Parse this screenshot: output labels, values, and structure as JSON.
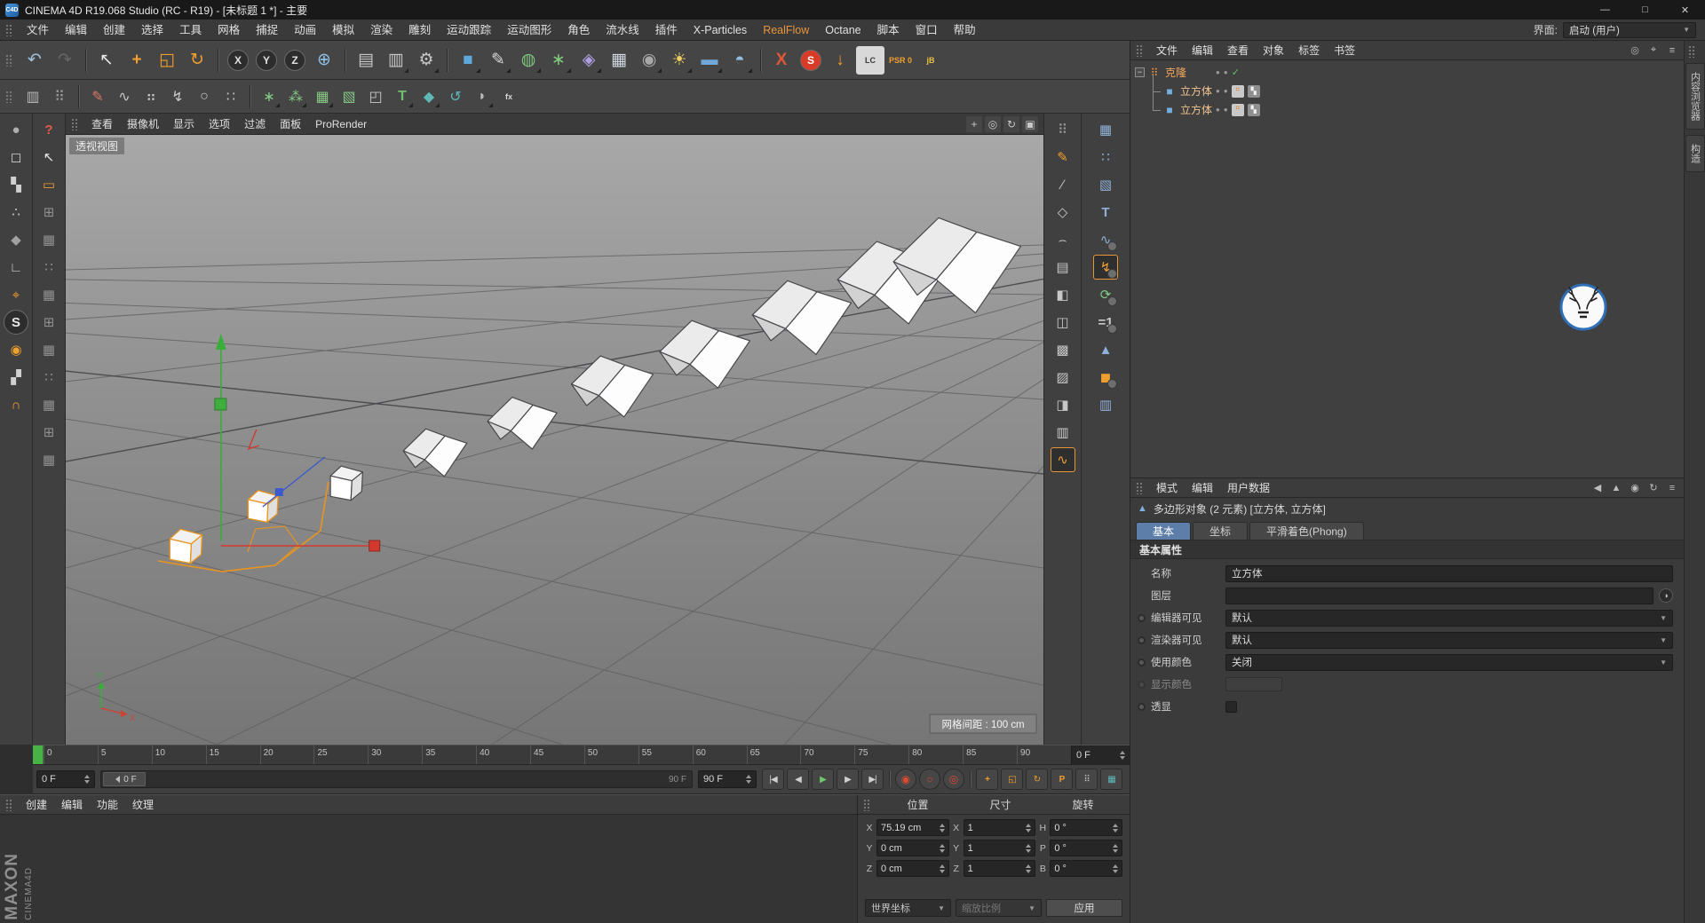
{
  "theme": {
    "accent_orange": "#ef9f2e",
    "tab_active_blue": "#5d7ea8",
    "play_green": "#6ec86e",
    "playhead_green": "#47b347"
  },
  "titlebar": {
    "app_icon": "C4D",
    "title": "CINEMA 4D R19.068 Studio (RC - R19) - [未标题 1 *] - 主要",
    "minimize": "—",
    "maximize": "□",
    "close": "✕"
  },
  "menubar": {
    "items": [
      {
        "label": "文件"
      },
      {
        "label": "编辑"
      },
      {
        "label": "创建"
      },
      {
        "label": "选择"
      },
      {
        "label": "工具"
      },
      {
        "label": "网格"
      },
      {
        "label": "捕捉"
      },
      {
        "label": "动画"
      },
      {
        "label": "模拟"
      },
      {
        "label": "渲染"
      },
      {
        "label": "雕刻"
      },
      {
        "label": "运动跟踪"
      },
      {
        "label": "运动图形"
      },
      {
        "label": "角色"
      },
      {
        "label": "流水线"
      },
      {
        "label": "插件"
      },
      {
        "label": "X-Particles"
      },
      {
        "label": "RealFlow",
        "accent": true
      },
      {
        "label": "Octane"
      },
      {
        "label": "脚本"
      },
      {
        "label": "窗口"
      },
      {
        "label": "帮助"
      }
    ],
    "interface_label": "界面:",
    "interface_value": "启动 (用户)"
  },
  "toolbar_main": {
    "icons": [
      {
        "name": "undo-icon",
        "glyph": "↶",
        "color": "#9fc0d8"
      },
      {
        "name": "redo-icon",
        "glyph": "↷",
        "color": "#666666",
        "disabled": true
      },
      {
        "sep": true
      },
      {
        "name": "live-selection-icon",
        "glyph": "↖",
        "color": "#e8e8e8"
      },
      {
        "name": "move-tool-icon",
        "glyph": "+",
        "color": "#ef9f2e",
        "bold": true
      },
      {
        "name": "scale-tool-icon",
        "glyph": "◱",
        "color": "#ef9f2e"
      },
      {
        "name": "rotate-tool-icon",
        "glyph": "↻",
        "color": "#ef9f2e"
      },
      {
        "sep": true
      },
      {
        "name": "lock-x-axis-button",
        "glyph": "X",
        "circle": true,
        "color": "#e0e0e0"
      },
      {
        "name": "lock-y-axis-button",
        "glyph": "Y",
        "circle": true,
        "color": "#e0e0e0"
      },
      {
        "name": "lock-z-axis-button",
        "glyph": "Z",
        "circle": true,
        "color": "#e0e0e0"
      },
      {
        "name": "coordinate-system-button",
        "glyph": "⊕",
        "color": "#8fc0e8"
      },
      {
        "sep": true
      },
      {
        "name": "render-view-button",
        "glyph": "▤",
        "color": "#c8c8c8"
      },
      {
        "name": "render-picture-viewer-button",
        "glyph": "▥",
        "color": "#c8c8c8",
        "corner": true
      },
      {
        "name": "render-settings-button",
        "glyph": "⚙",
        "color": "#c8c8c8",
        "corner": true
      },
      {
        "sep": true
      },
      {
        "name": "primitive-cube-button",
        "glyph": "■",
        "color": "#5fa8dc",
        "corner": true
      },
      {
        "name": "spline-pen-button",
        "glyph": "✎",
        "color": "#d8d8d8",
        "corner": true
      },
      {
        "name": "subdivision-surface-button",
        "glyph": "◍",
        "color": "#7fca7f",
        "corner": true
      },
      {
        "name": "mograph-cloner-button",
        "glyph": "∗",
        "color": "#7fca7f",
        "corner": true
      },
      {
        "name": "deformer-button",
        "glyph": "◈",
        "color": "#b09fe0",
        "corner": true
      },
      {
        "name": "content-table-button",
        "glyph": "▦",
        "color": "#cfd8e2"
      },
      {
        "name": "camera-button",
        "glyph": "◉",
        "color": "#a8a8a8",
        "corner": true
      },
      {
        "name": "light-button",
        "glyph": "☀",
        "color": "#f0d060",
        "corner": true
      },
      {
        "name": "floor-button",
        "glyph": "▬",
        "color": "#6fa8d8",
        "corner": true
      },
      {
        "name": "sky-button",
        "glyph": "◓",
        "color": "#90bce0",
        "corner": true
      },
      {
        "sep": true
      },
      {
        "name": "xparticles-button",
        "glyph": "X",
        "color": "#e05838",
        "bold": true
      },
      {
        "name": "solo-plugin-button",
        "glyph": "S",
        "circle": true,
        "bg": "#d83c28",
        "color": "#ffffff"
      },
      {
        "name": "drop-to-floor-button",
        "glyph": "↓",
        "color": "#ef9f2e",
        "bold": true
      },
      {
        "name": "lc-plugin-button",
        "glyph": "LC",
        "txt": true,
        "bg": "#d8d8d8",
        "color": "#3a3a3a"
      },
      {
        "name": "psr-reset-button",
        "glyph": "PSR 0",
        "txt": true,
        "color": "#ef9f2e"
      },
      {
        "name": "jb-plugin-button",
        "glyph": "jB",
        "txt": true,
        "color": "#e8c040"
      }
    ]
  },
  "toolbar_modeling": {
    "icons": [
      {
        "name": "layout-panes-icon",
        "glyph": "▥",
        "color": "#b8b8b8"
      },
      {
        "name": "command-palette-icon",
        "glyph": "⠿",
        "color": "#9a9a9a"
      },
      {
        "sep": true
      },
      {
        "name": "sketch-pen-icon",
        "glyph": "✎",
        "color": "#d87868"
      },
      {
        "name": "sketch-smooth-icon",
        "glyph": "∿",
        "color": "#c8c8c8"
      },
      {
        "name": "spline-sketch-icon",
        "glyph": "⠶",
        "color": "#c8c8c8"
      },
      {
        "name": "spline-zigzag-icon",
        "glyph": "↯",
        "color": "#c8c8c8"
      },
      {
        "name": "spline-circle-icon",
        "glyph": "○",
        "color": "#c8c8c8"
      },
      {
        "name": "spline-grid-icon",
        "glyph": "∷",
        "color": "#c8c8c8"
      },
      {
        "sep": true
      },
      {
        "name": "atom-array-icon",
        "glyph": "∗",
        "color": "#84c884",
        "corner": true
      },
      {
        "name": "metaball-icon",
        "glyph": "⁂",
        "color": "#84c884",
        "corner": true
      },
      {
        "name": "boole-icon",
        "glyph": "▦",
        "color": "#84c884",
        "corner": true
      },
      {
        "name": "instance-icon",
        "glyph": "▧",
        "color": "#84c884"
      },
      {
        "name": "corner-tool-icon",
        "glyph": "◰",
        "color": "#c8c8c8"
      },
      {
        "name": "text-object-icon",
        "glyph": "T",
        "color": "#6fbf6f",
        "bold": true,
        "corner": true
      },
      {
        "name": "platonic-icon",
        "glyph": "◆",
        "color": "#5fb8b8",
        "corner": true
      },
      {
        "name": "helix-icon",
        "glyph": "↺",
        "color": "#5fb8b8"
      },
      {
        "name": "lathe-icon",
        "glyph": "◗",
        "color": "#b8b8b8",
        "corner": true
      },
      {
        "name": "xpresso-icon",
        "glyph": "fx",
        "txt": true,
        "color": "#d8d8d8"
      }
    ]
  },
  "left_toolbar_primary": {
    "icons": [
      {
        "name": "make-editable-icon",
        "glyph": "●",
        "color": "#b0b0b0"
      },
      {
        "name": "model-mode-icon",
        "glyph": "◻",
        "color": "#d0d0d0"
      },
      {
        "name": "texture-mode-icon",
        "glyph": "▚",
        "color": "#d0d0d0"
      },
      {
        "name": "points-mode-icon",
        "glyph": "∴",
        "color": "#d0d0d0"
      },
      {
        "name": "polygons-mode-icon",
        "glyph": "◆",
        "color": "#a0a0a0"
      },
      {
        "name": "workplane-mode-icon",
        "glyph": "∟",
        "color": "#d0d0d0"
      },
      {
        "name": "axis-mode-icon",
        "glyph": "⌖",
        "color": "#ef9f2e"
      },
      {
        "name": "viewport-solo-icon",
        "glyph": "S",
        "circle": true,
        "color": "#e8e8e8"
      },
      {
        "name": "paint-bucket-icon",
        "glyph": "◉",
        "color": "#ef9f2e"
      },
      {
        "name": "lock-workplane-icon",
        "glyph": "▞",
        "color": "#d0d0d0"
      },
      {
        "name": "snap-enable-icon",
        "glyph": "∩",
        "color": "#ef9f2e"
      }
    ]
  },
  "left_toolbar_secondary": {
    "icons": [
      {
        "name": "help-icon",
        "glyph": "?",
        "color": "#e05a48",
        "bold": true
      },
      {
        "name": "select-arrow-icon",
        "glyph": "↖",
        "color": "#e8e8e8"
      },
      {
        "name": "rectangle-select-icon",
        "glyph": "▭",
        "color": "#ef9f2e"
      },
      {
        "name": "move-palette-icon",
        "glyph": "⊞",
        "color": "#909090"
      },
      {
        "name": "scale-palette-icon",
        "glyph": "▦",
        "color": "#909090"
      },
      {
        "name": "rotate-palette-icon",
        "glyph": "∷",
        "color": "#909090"
      },
      {
        "name": "grid-palette-icon-1",
        "glyph": "▦",
        "color": "#909090"
      },
      {
        "name": "grid-palette-icon-2",
        "glyph": "⊞",
        "color": "#909090"
      },
      {
        "name": "grid-palette-icon-3",
        "glyph": "▦",
        "color": "#909090"
      },
      {
        "name": "grid-palette-icon-4",
        "glyph": "∷",
        "color": "#909090"
      },
      {
        "name": "grid-palette-icon-5",
        "glyph": "▦",
        "color": "#909090"
      },
      {
        "name": "grid-palette-icon-6",
        "glyph": "⊞",
        "color": "#909090"
      },
      {
        "name": "grid-palette-icon-7",
        "glyph": "▦",
        "color": "#909090"
      }
    ]
  },
  "viewport": {
    "menu": [
      {
        "label": "查看"
      },
      {
        "label": "摄像机"
      },
      {
        "label": "显示"
      },
      {
        "label": "选项"
      },
      {
        "label": "过滤"
      },
      {
        "label": "面板"
      },
      {
        "label": "ProRender"
      }
    ],
    "view_controls": [
      {
        "name": "pan-view-icon",
        "glyph": "+"
      },
      {
        "name": "zoom-view-icon",
        "glyph": "◎"
      },
      {
        "name": "orbit-view-icon",
        "glyph": "↻"
      },
      {
        "name": "maximize-view-icon",
        "glyph": "▣"
      }
    ],
    "label": "透视视图",
    "grid_info": "网格间距 : 100 cm"
  },
  "right_palette_a": {
    "icons": [
      {
        "name": "dots-palette-icon",
        "glyph": "⠿",
        "color": "#9a9a9a"
      },
      {
        "name": "spline-pen-icon",
        "glyph": "✎",
        "color": "#ef9f2e"
      },
      {
        "name": "knife-icon",
        "glyph": "∕",
        "color": "#c8c8c8"
      },
      {
        "name": "polygon-pen-icon",
        "glyph": "◇",
        "color": "#c8c8c8"
      },
      {
        "name": "arc-tool-icon",
        "glyph": "⌢",
        "color": "#c8c8c8"
      },
      {
        "name": "extrude-icon",
        "glyph": "▤",
        "color": "#c8c8c8"
      },
      {
        "name": "inner-extrude-icon",
        "glyph": "◧",
        "color": "#c8c8c8"
      },
      {
        "name": "bevel-icon",
        "glyph": "◫",
        "color": "#c8c8c8"
      },
      {
        "name": "bridge-icon",
        "glyph": "▩",
        "color": "#c8c8c8"
      },
      {
        "name": "stitch-sew-icon",
        "glyph": "▨",
        "color": "#c8c8c8"
      },
      {
        "name": "weld-icon",
        "glyph": "◨",
        "color": "#c8c8c8"
      },
      {
        "name": "close-polygon-icon",
        "glyph": "▥",
        "color": "#c8c8c8"
      },
      {
        "name": "spline-smooth-icon",
        "glyph": "∿",
        "color": "#ef9f2e",
        "selected": true
      }
    ]
  },
  "right_palette_b": {
    "icons": [
      {
        "name": "cloner-icon",
        "glyph": "▦",
        "color": "#8fb0d8"
      },
      {
        "name": "matrix-icon",
        "glyph": "∷",
        "color": "#8fb0d8"
      },
      {
        "name": "fracture-icon",
        "glyph": "▧",
        "color": "#8fb0d8"
      },
      {
        "name": "motext-icon",
        "glyph": "T",
        "color": "#8fb0d8",
        "bold": true
      },
      {
        "name": "tracer-icon",
        "glyph": "∿",
        "color": "#8fb0d8",
        "gear": true
      },
      {
        "name": "mospline-icon",
        "glyph": "↯",
        "color": "#ef9f2e",
        "selected": true,
        "gear": true
      },
      {
        "name": "random-effector-icon",
        "glyph": "⟳",
        "color": "#84c884",
        "gear": true
      },
      {
        "name": "plain-effector-icon",
        "glyph": "=1",
        "txt": true,
        "color": "#c8c8c8",
        "gear": true
      },
      {
        "name": "polyfx-icon",
        "glyph": "▲",
        "color": "#8fb0d8"
      },
      {
        "name": "pushapart-effector-icon",
        "glyph": "◼",
        "color": "#ef9f2e",
        "gear": true
      },
      {
        "name": "extrude-mo-icon",
        "glyph": "▥",
        "color": "#8fb0d8"
      }
    ]
  },
  "timeline": {
    "ticks": [
      "0",
      "5",
      "10",
      "15",
      "20",
      "25",
      "30",
      "35",
      "40",
      "45",
      "50",
      "55",
      "60",
      "65",
      "70",
      "75",
      "80",
      "85",
      "90"
    ],
    "current_frame": "0 F",
    "range_start": "0 F",
    "range_end": "90 F",
    "slider_handle_label": "0 F",
    "slider_end_label": "90 F",
    "transport": [
      {
        "name": "goto-start-button",
        "glyph": "|◀"
      },
      {
        "name": "previous-frame-button",
        "glyph": "◀"
      },
      {
        "name": "play-button",
        "glyph": "▶",
        "color": "#6ec86e"
      },
      {
        "name": "next-frame-button",
        "glyph": "▶"
      },
      {
        "name": "goto-end-button",
        "glyph": "▶|"
      },
      {
        "sep": true
      },
      {
        "name": "record-keyframe-button",
        "glyph": "◉",
        "color": "#e04a32",
        "round": true
      },
      {
        "name": "autokeying-button",
        "glyph": "○",
        "color": "#e04a32",
        "round": true
      },
      {
        "name": "keyframe-selection-button",
        "glyph": "◎",
        "color": "#e04a32",
        "round": true
      },
      {
        "sep": true
      },
      {
        "name": "position-key-toggle",
        "glyph": "+",
        "color": "#ef9f2e",
        "bold": true
      },
      {
        "name": "scale-key-toggle",
        "glyph": "◱",
        "color": "#ef9f2e"
      },
      {
        "name": "rotation-key-toggle",
        "glyph": "↻",
        "color": "#ef9f2e"
      },
      {
        "name": "parameter-key-toggle",
        "glyph": "P",
        "color": "#ef9f2e",
        "bold": true
      },
      {
        "name": "point-level-animation-toggle",
        "glyph": "⠿",
        "color": "#c8c8c8"
      },
      {
        "name": "playback-settings-button",
        "glyph": "▦",
        "color": "#5fb8b8"
      }
    ]
  },
  "material_manager": {
    "menu": [
      {
        "label": "创建"
      },
      {
        "label": "编辑"
      },
      {
        "label": "功能"
      },
      {
        "label": "纹理"
      }
    ],
    "logo_primary": "MAXON",
    "logo_secondary": "CINEMA4D"
  },
  "coordinates": {
    "columns": [
      "位置",
      "尺寸",
      "旋转"
    ],
    "rows": [
      {
        "pos_label": "X",
        "pos": "75.19 cm",
        "size_label": "X",
        "size": "1",
        "rot_label": "H",
        "rot": "0 °"
      },
      {
        "pos_label": "Y",
        "pos": "0 cm",
        "size_label": "Y",
        "size": "1",
        "rot_label": "P",
        "rot": "0 °"
      },
      {
        "pos_label": "Z",
        "pos": "0 cm",
        "size_label": "Z",
        "size": "1",
        "rot_label": "B",
        "rot": "0 °"
      }
    ],
    "space_select": "世界坐标",
    "scale_select": "缩放比例",
    "apply": "应用"
  },
  "object_manager": {
    "menu": [
      {
        "label": "文件"
      },
      {
        "label": "编辑"
      },
      {
        "label": "查看"
      },
      {
        "label": "对象"
      },
      {
        "label": "标签"
      },
      {
        "label": "书签"
      }
    ],
    "panel_icons": [
      {
        "name": "search-icon",
        "glyph": "◎"
      },
      {
        "name": "target-icon",
        "glyph": "⌖"
      },
      {
        "name": "panel-menu-icon",
        "glyph": "≡"
      }
    ],
    "objects": [
      {
        "name": "克隆"
      },
      {
        "name": "立方体"
      },
      {
        "name": "立方体"
      }
    ]
  },
  "attributes": {
    "menu": [
      {
        "label": "模式"
      },
      {
        "label": "编辑"
      },
      {
        "label": "用户数据"
      }
    ],
    "panel_icons": [
      {
        "name": "back-icon",
        "glyph": "◀"
      },
      {
        "name": "forward-icon",
        "glyph": "▲"
      },
      {
        "name": "lock-icon",
        "glyph": "◉"
      },
      {
        "name": "refresh-icon",
        "glyph": "↻"
      },
      {
        "name": "panel-menu-icon",
        "glyph": "≡"
      }
    ],
    "object_info": "多边形对象 (2 元素) [立方体, 立方体]",
    "tabs": [
      {
        "label": "基本",
        "active": true
      },
      {
        "label": "坐标"
      },
      {
        "label": "平滑着色(Phong)"
      }
    ],
    "section": "基本属性",
    "rows": {
      "name_label": "名称",
      "name_value": "立方体",
      "layer_label": "图层",
      "editor_visibility_label": "编辑器可见",
      "editor_visibility_value": "默认",
      "render_visibility_label": "渲染器可见",
      "render_visibility_value": "默认",
      "use_color_label": "使用颜色",
      "use_color_value": "关闭",
      "display_color_label": "显示颜色",
      "xray_label": "透显"
    }
  },
  "right_dock": {
    "tabs": [
      {
        "label": "内容浏览器"
      },
      {
        "label": "构造"
      }
    ]
  }
}
